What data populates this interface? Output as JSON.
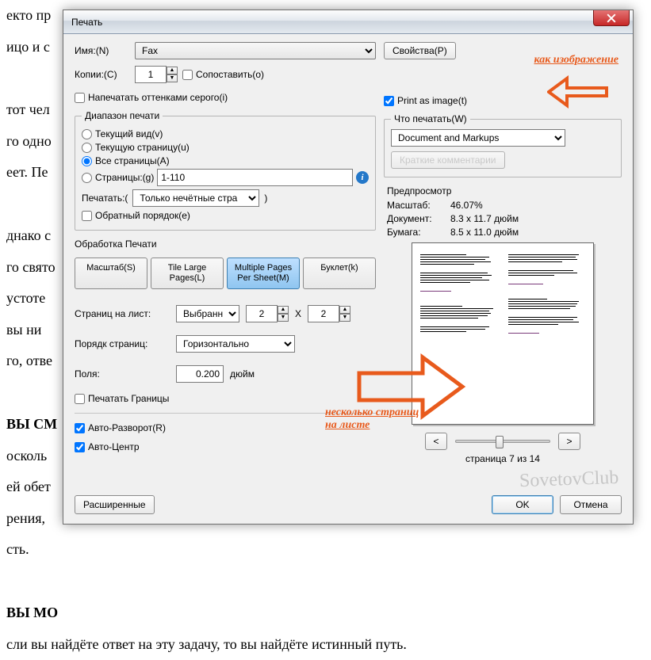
{
  "bgText": "екто пр                                                                                                           . Будд\nицо и с                                                                                                            ете\n\nтот чел                                                                                                           еле\nго одно                                                                                                           то\nеет. Пе\n\nднако с                                                                                                           ие\nго свято                                                                                                          дд\nустоте                                                                                                            тол\nвы ни                                                                                                             ы\nго, отве                                                                                                          ).\n\n ВЫ СМ\nосколь                                                                                                           т\nей обет                                                                                                           о\nрения,                                                                                                            с\nсть.\n\n ВЫ МО\nсли вы найдёте ответ на эту задачу, то вы найдёте истинный путь.",
  "dialog": {
    "title": "Печать",
    "left": {
      "nameLabel": "Имя:(N)",
      "nameValue": "Fax",
      "copiesLabel": "Копии:(C)",
      "copiesValue": "1",
      "collateLabel": "Сопоставить(o)",
      "grayscaleLabel": "Напечатать оттенками серого(i)",
      "rangeGroup": "Диапазон печати",
      "rCurView": "Текущий вид(v)",
      "rCurPage": "Текущую страницу(u)",
      "rAll": "Все страницы(A)",
      "rPages": "Страницы:(g)",
      "pagesValue": "1-110",
      "subsetLabel": "Печатать:(",
      "subsetValue": "Только нечётные стра",
      "subsetTail": ")",
      "reverseLabel": "Обратный порядок(e)",
      "handlingGroup": "Обработка Печати",
      "segScale": "Масштаб(S)",
      "segTile": "Tile Large Pages(L)",
      "segMulti": "Multiple Pages Per Sheet(M)",
      "segBooklet": "Буклет(k)",
      "ppsLabel": "Страниц на лист:",
      "ppsMode": "Выбранные",
      "ppsCols": "2",
      "ppsX": "X",
      "ppsRows": "2",
      "orderLabel": "Порядк страниц:",
      "orderValue": "Горизонтально",
      "marginLabel": "Поля:",
      "marginValue": "0.200",
      "marginUnit": "дюйм",
      "bordersLabel": "Печатать Границы",
      "autoRotate": "Авто-Разворот(R)",
      "autoCenter": "Авто-Центр",
      "advanced": "Расширенные"
    },
    "right": {
      "propsBtn": "Свойства(P)",
      "printAsImage": "Print as image(t)",
      "whatGroup": "Что печатать(W)",
      "whatValue": "Document and Markups",
      "summarize": "Краткие комментарии",
      "previewTitle": "Предпросмотр",
      "scaleLbl": "Масштаб:",
      "scaleVal": "46.07%",
      "docLbl": "Документ:",
      "docVal": "8.3 x 11.7 дюйм",
      "paperLbl": "Бумага:",
      "paperVal": "8.5 x 11.0 дюйм",
      "pageInfo": "страница 7 из 14",
      "ok": "OK",
      "cancel": "Отмена"
    }
  },
  "annotations": {
    "asImage": "как изображение",
    "multiOnSheet1": "несколько страниц",
    "multiOnSheet2": "на листе"
  },
  "watermark": "SovetovClub"
}
